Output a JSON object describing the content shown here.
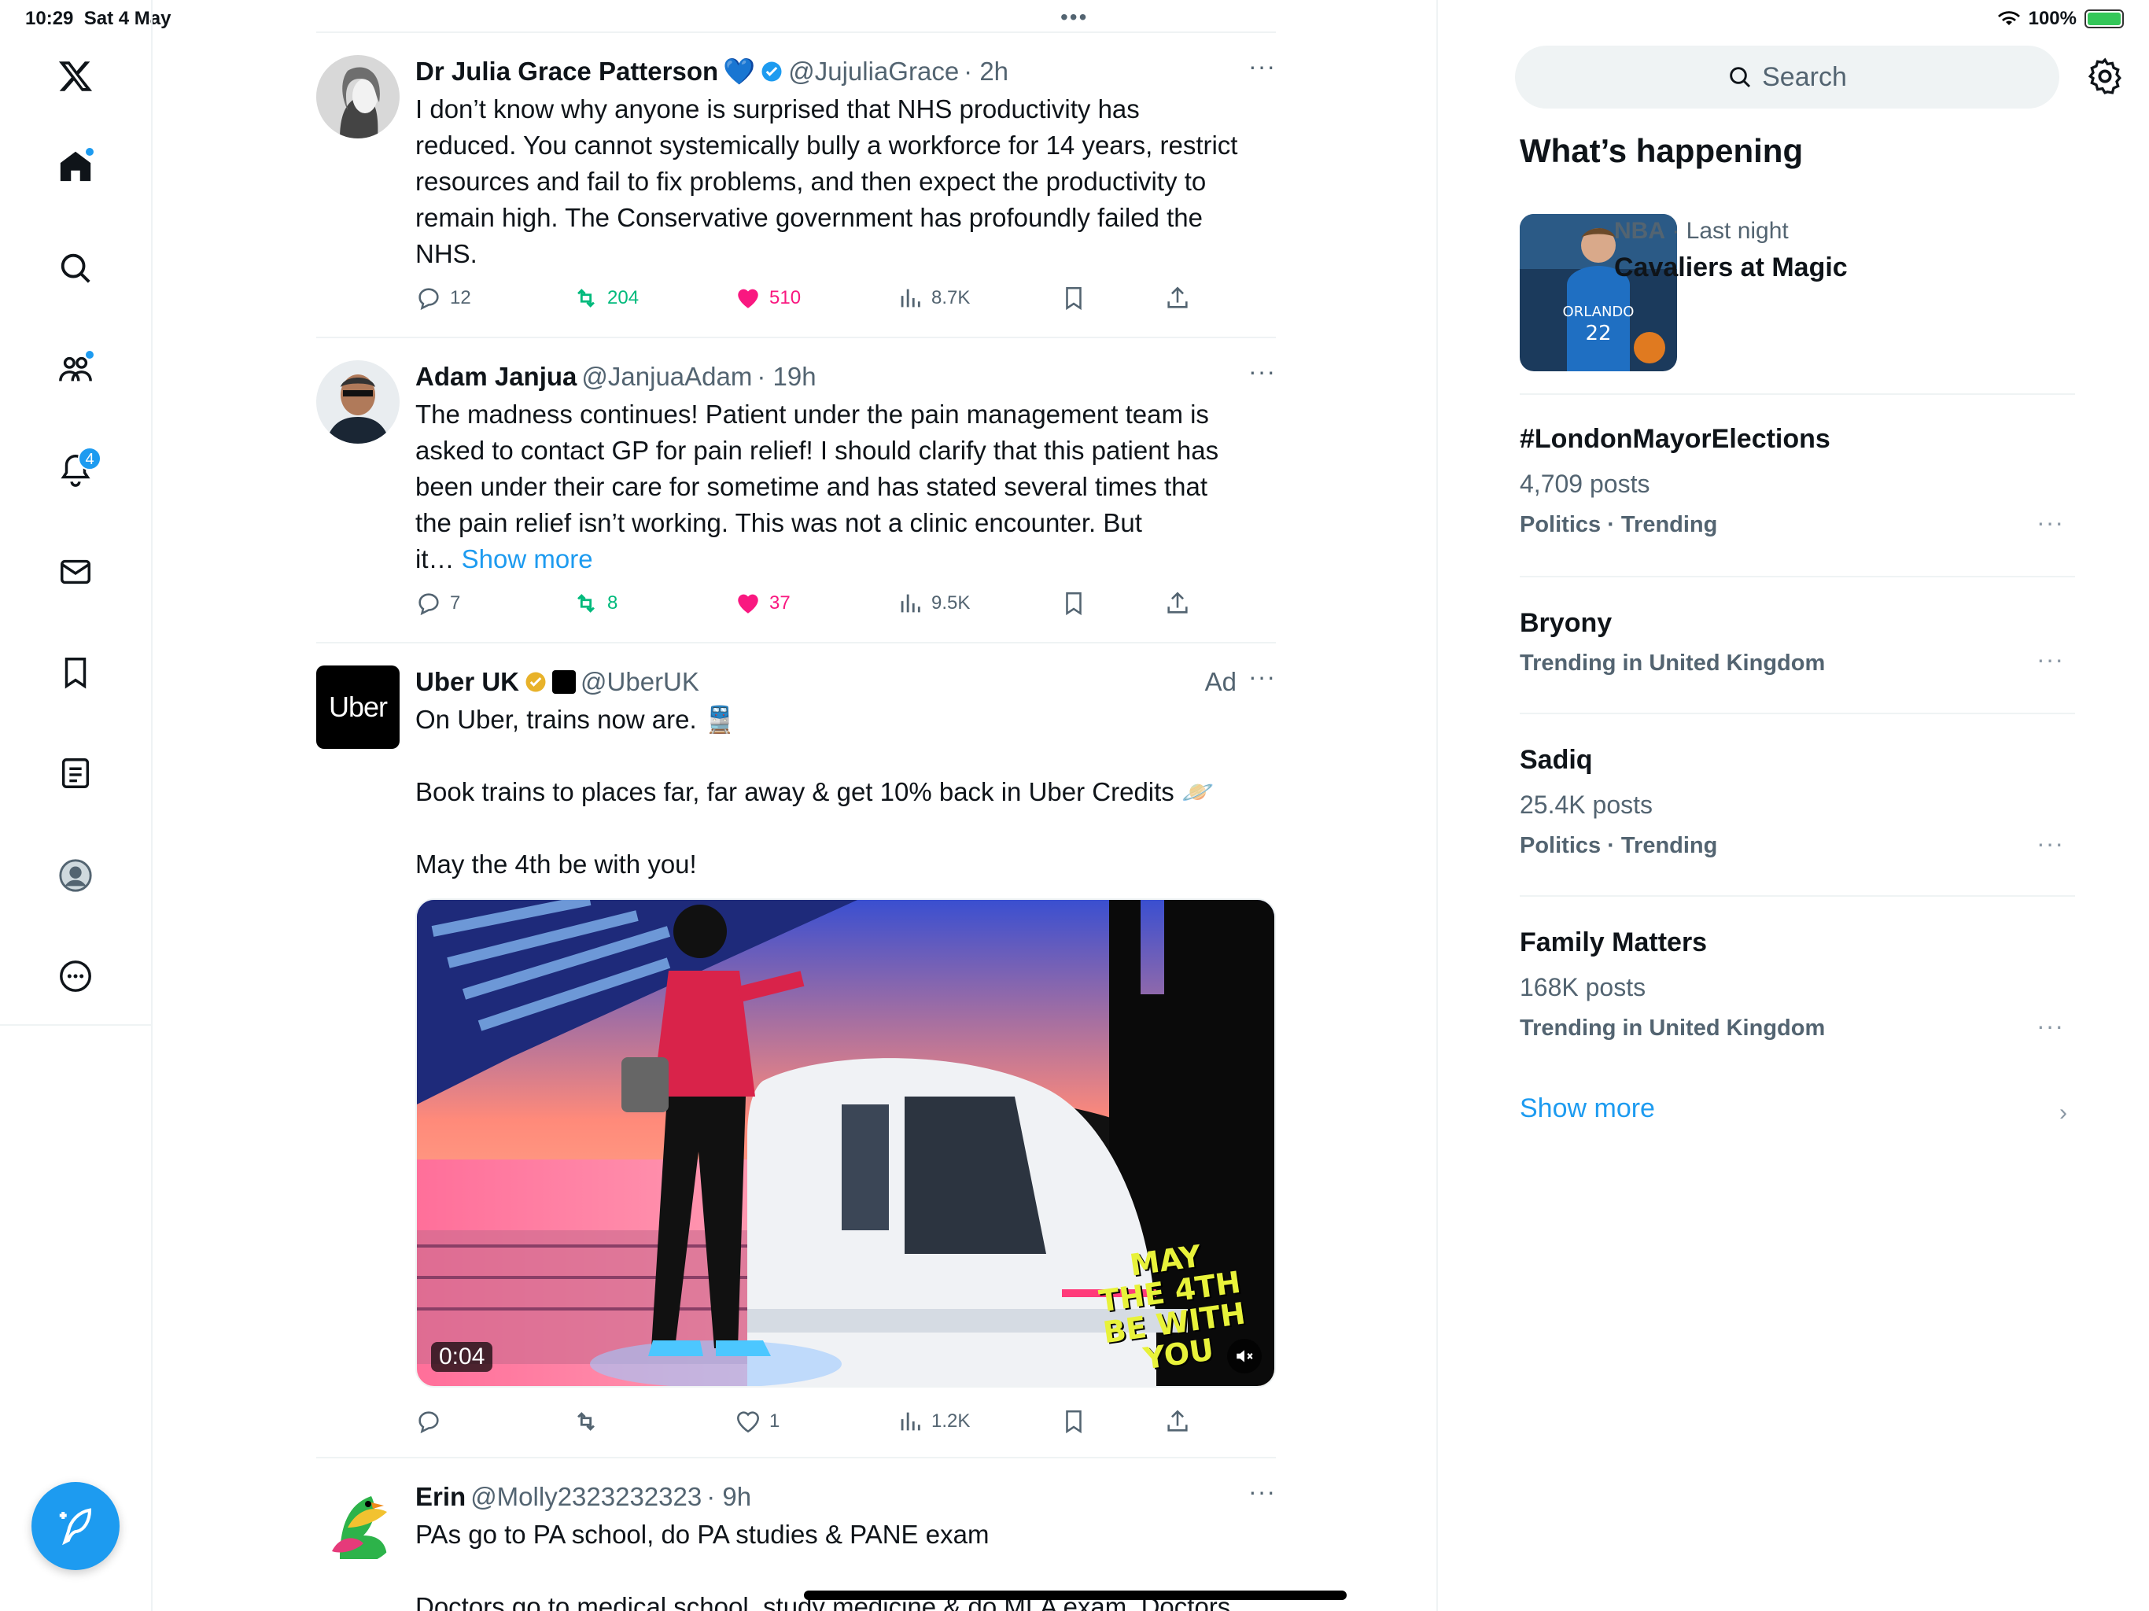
{
  "status": {
    "time": "10:29",
    "date": "Sat 4 May",
    "battery": "100%",
    "battery_level": 1.0
  },
  "nav": {
    "items": [
      {
        "name": "home"
      },
      {
        "name": "explore"
      },
      {
        "name": "communities"
      },
      {
        "name": "notifications",
        "badge": "4"
      },
      {
        "name": "messages"
      },
      {
        "name": "bookmarks"
      },
      {
        "name": "lists"
      },
      {
        "name": "profile"
      },
      {
        "name": "more"
      }
    ]
  },
  "feed": {
    "tweets": [
      {
        "name": "Dr Julia Grace Patterson",
        "emoji": "💙",
        "handle": "@JujuliaGrace",
        "time": "· 2h",
        "text": "I don’t know why anyone is surprised that NHS productivity has\nreduced. You cannot systemically bully a workforce for 14 years, restrict\nresources and fail to fix problems, and then expect the productivity to\nremain high. The Conservative government has profoundly failed the\nNHS.",
        "replies": "12",
        "reposts": "204",
        "likes": "510",
        "views": "8.7K"
      },
      {
        "name": "Adam Janjua",
        "handle": "@JanjuaAdam",
        "time": "· 19h",
        "text": "The madness continues! Patient under the pain management team is\nasked to contact GP for pain relief! I should clarify that this patient has\nbeen under their care for sometime and has stated several times that\nthe pain relief isn’t working. This was not a clinic encounter. But\nit…",
        "show_more": "Show more",
        "replies": "7",
        "reposts": "8",
        "likes": "37",
        "views": "9.5K"
      },
      {
        "name": "Uber UK",
        "handle": "@UberUK",
        "ad": "Ad",
        "avatar_text": "Uber",
        "text1": "On Uber, trains now are. 🚆",
        "text2": "Book trains to places far, far away & get 10% back in Uber Credits 🪐",
        "text3": "May the 4th be with you!",
        "video_time": "0:04",
        "banner": [
          "MAY",
          "THE 4TH",
          "BE WITH",
          "YOU"
        ],
        "replies": "",
        "reposts": "",
        "likes": "1",
        "views": "1.2K"
      },
      {
        "name": "Erin",
        "handle": "@Molly2323232323",
        "time": "· 9h",
        "text1": "PAs go to PA school, do PA studies & PANE exam",
        "text2": "Doctors go to medical school, study medicine & do MLA exam. Doctors"
      }
    ]
  },
  "sidebar": {
    "search_placeholder": "Search",
    "whats_happening": "What’s happening",
    "nba": {
      "league": "NBA",
      "when": "· Last night",
      "title": "Cavaliers at Magic",
      "jersey": "ORLANDO",
      "number": "22"
    },
    "trends": [
      {
        "title": "#LondonMayorElections",
        "posts": "4,709 posts",
        "meta": "Politics · Trending"
      },
      {
        "title": "Bryony",
        "posts": "",
        "meta": "Trending in United Kingdom"
      },
      {
        "title": "Sadiq",
        "posts": "25.4K posts",
        "meta": "Politics · Trending"
      },
      {
        "title": "Family Matters",
        "posts": "168K posts",
        "meta": "Trending in United Kingdom"
      }
    ],
    "show_more": "Show more"
  }
}
